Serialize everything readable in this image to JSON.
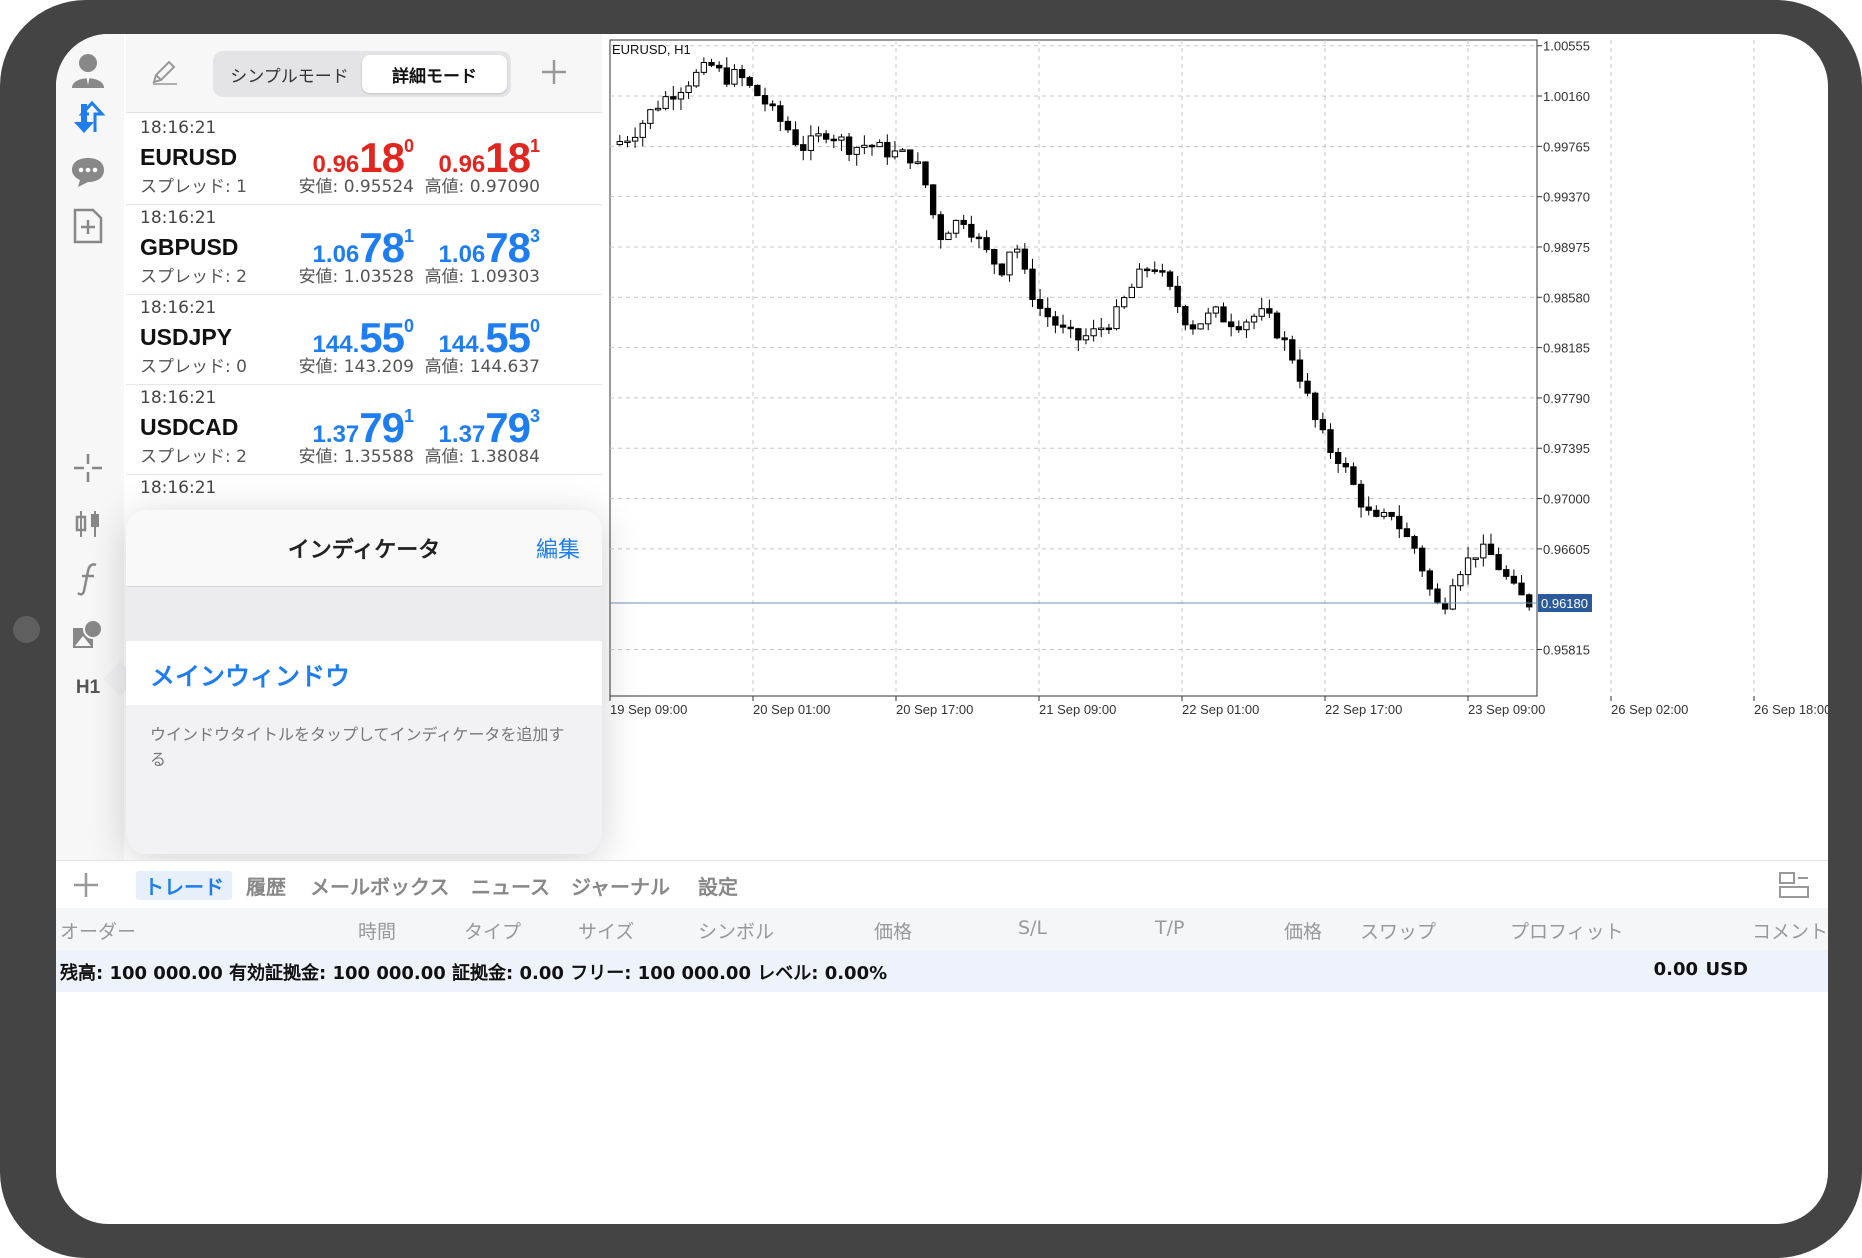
{
  "mode_switch": {
    "simple": "シンプルモード",
    "advanced": "詳細モード"
  },
  "quotes": [
    {
      "time": "18:16:21",
      "symbol": "EURUSD",
      "spread": "スプレッド: 1",
      "bid": {
        "small": "0.96",
        "big": "18",
        "sup": "0"
      },
      "ask": {
        "small": "0.96",
        "big": "18",
        "sup": "1"
      },
      "low": "安値: 0.95524",
      "high": "高値: 0.97090",
      "color": "#e0261f"
    },
    {
      "time": "18:16:21",
      "symbol": "GBPUSD",
      "spread": "スプレッド: 2",
      "bid": {
        "small": "1.06",
        "big": "78",
        "sup": "1"
      },
      "ask": {
        "small": "1.06",
        "big": "78",
        "sup": "3"
      },
      "low": "安値: 1.03528",
      "high": "高値: 1.09303",
      "color": "#1e7df0"
    },
    {
      "time": "18:16:21",
      "symbol": "USDJPY",
      "spread": "スプレッド: 0",
      "bid": {
        "small": "144.",
        "big": "55",
        "sup": "0"
      },
      "ask": {
        "small": "144.",
        "big": "55",
        "sup": "0"
      },
      "low": "安値: 143.209",
      "high": "高値: 144.637",
      "color": "#1e7df0"
    },
    {
      "time": "18:16:21",
      "symbol": "USDCAD",
      "spread": "スプレッド: 2",
      "bid": {
        "small": "1.37",
        "big": "79",
        "sup": "1"
      },
      "ask": {
        "small": "1.37",
        "big": "79",
        "sup": "3"
      },
      "low": "安値: 1.35588",
      "high": "高値: 1.38084",
      "color": "#1e7df0"
    },
    {
      "time": "18:16:21"
    }
  ],
  "indicator_popover": {
    "title": "インディケータ",
    "edit": "編集",
    "main_window": "メインウィンドウ",
    "hint": "ウインドウタイトルをタップしてインディケータを追加する"
  },
  "toolbar": {
    "timeframe": "H1"
  },
  "chart_data": {
    "type": "candlestick",
    "title": "EURUSD, H1",
    "current_price": "0.96180",
    "y_ticks": [
      "1.00555",
      "1.00160",
      "0.99765",
      "0.99370",
      "0.98975",
      "0.98580",
      "0.98185",
      "0.97790",
      "0.97395",
      "0.97000",
      "0.96605",
      "0.96180",
      "0.95815"
    ],
    "x_ticks": [
      "19 Sep 09:00",
      "20 Sep 01:00",
      "20 Sep 17:00",
      "21 Sep 09:00",
      "22 Sep 01:00",
      "22 Sep 17:00",
      "23 Sep 09:00",
      "26 Sep 02:00",
      "26 Sep 18:00"
    ],
    "ylim": [
      0.9545,
      1.006
    ],
    "close_path": [
      0.9978,
      0.9982,
      0.999,
      1.0003,
      1.0013,
      1.002,
      1.0027,
      1.0035,
      1.004,
      1.003,
      1.0033,
      1.0022,
      1.0013,
      1.0,
      0.999,
      0.9975,
      0.998,
      0.9988,
      0.9983,
      0.9975,
      0.9978,
      0.9976,
      0.9972,
      0.997,
      0.9968,
      0.9945,
      0.9905,
      0.9915,
      0.992,
      0.9905,
      0.989,
      0.988,
      0.9905,
      0.987,
      0.985,
      0.984,
      0.983,
      0.9825,
      0.9828,
      0.9835,
      0.9842,
      0.986,
      0.9875,
      0.9885,
      0.987,
      0.9852,
      0.9835,
      0.984,
      0.9846,
      0.984,
      0.9838,
      0.9843,
      0.9845,
      0.983,
      0.9815,
      0.979,
      0.976,
      0.974,
      0.973,
      0.971,
      0.969,
      0.968,
      0.969,
      0.9672,
      0.966,
      0.963,
      0.961,
      0.964,
      0.965,
      0.966,
      0.9655,
      0.964,
      0.9625,
      0.9618
    ],
    "candle_count": 120,
    "grid": true
  },
  "terminal": {
    "tabs": [
      "トレード",
      "履歴",
      "メールボックス",
      "ニュース",
      "ジャーナル",
      "設定"
    ],
    "columns": [
      "オーダー",
      "時間",
      "タイプ",
      "サイズ",
      "シンボル",
      "価格",
      "S/L",
      "T/P",
      "価格",
      "スワップ",
      "プロフィット",
      "コメント"
    ],
    "balance_line": "残高: 100 000.00 有効証拠金: 100 000.00 証拠金: 0.00 フリー: 100 000.00 レベル: 0.00%",
    "profit": "0.00",
    "currency": "USD"
  },
  "colors": {
    "accent": "#1e7df0",
    "bid_down": "#e0261f",
    "price_label_bg": "#2a5a9a"
  }
}
